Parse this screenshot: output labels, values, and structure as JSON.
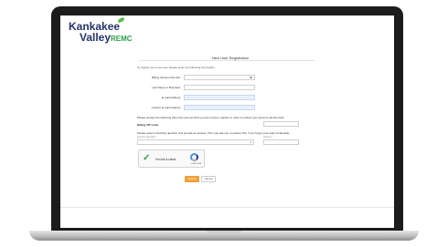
{
  "brand": {
    "name_line1": "Kankakee",
    "name_line2": "Valley",
    "name_suffix": "REMC"
  },
  "page": {
    "title": "New User Registration",
    "intro": "To register as a new user, please enter the following information."
  },
  "form": {
    "billing_account_label": "Billing Account Number:",
    "last_name_label": "Last Name or Business:",
    "email_label": "E-mail Address:",
    "confirm_email_label": "Confirm E-mail Address:",
    "identity_prompt": "Please answer the following about the account that you are trying to register in order to protect your account identity theft.",
    "billing_zip_label": "Billing ZIP Code:",
    "security_prompt": "Please select a Security question and provide an answer. This may ask you to answer this, if you forget your login credentials.",
    "security_question_label": "Security Question *",
    "answer_label": "Answer *"
  },
  "captcha": {
    "label": "I'm not a robot",
    "brand": "reCAPTCHA"
  },
  "buttons": {
    "submit": "Submit",
    "cancel": "Cancel"
  },
  "colors": {
    "brand_navy": "#25346a",
    "brand_green": "#2d9f4a",
    "submit_orange": "#f0a03c",
    "autofill_blue": "#e8f0fe"
  }
}
